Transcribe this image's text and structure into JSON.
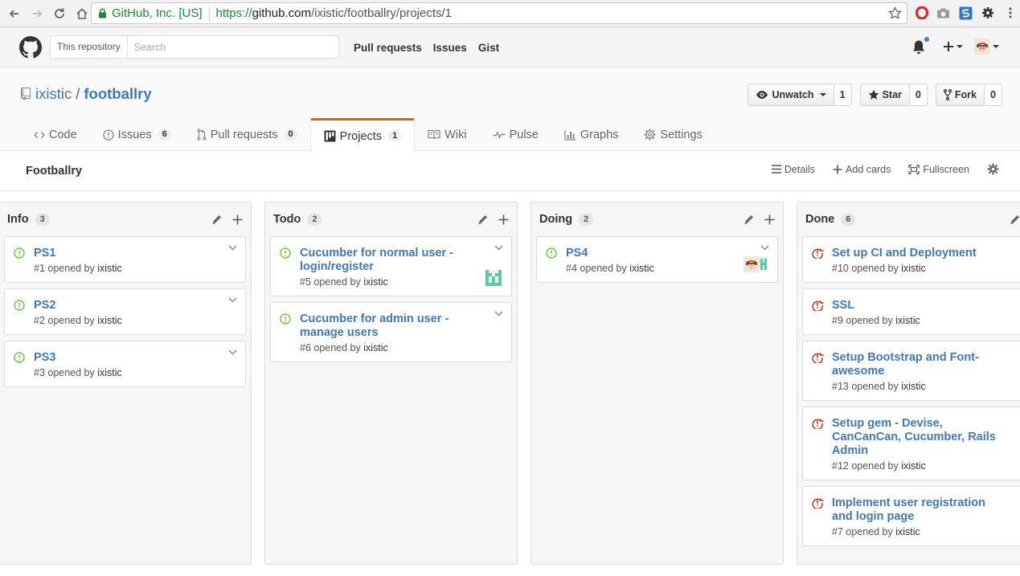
{
  "browser": {
    "secure_label": "GitHub, Inc. [US]",
    "url_scheme": "https://",
    "url_host": "github.com",
    "url_path": "/ixistic/footballry/projects/1"
  },
  "header": {
    "scope_label": "This repository",
    "search_placeholder": "Search",
    "nav": [
      "Pull requests",
      "Issues",
      "Gist"
    ]
  },
  "repo": {
    "owner": "ixistic",
    "separator": "/",
    "name": "footballry",
    "actions": {
      "watch_label": "Unwatch",
      "watch_count": "1",
      "star_label": "Star",
      "star_count": "0",
      "fork_label": "Fork",
      "fork_count": "0"
    },
    "tabs": [
      {
        "label": "Code",
        "icon": "code-icon",
        "counter": ""
      },
      {
        "label": "Issues",
        "icon": "issue-opened-icon",
        "counter": "6"
      },
      {
        "label": "Pull requests",
        "icon": "git-pull-request-icon",
        "counter": "0"
      },
      {
        "label": "Projects",
        "icon": "project-icon",
        "counter": "1",
        "selected": true
      },
      {
        "label": "Wiki",
        "icon": "book-icon",
        "counter": ""
      },
      {
        "label": "Pulse",
        "icon": "pulse-icon",
        "counter": ""
      },
      {
        "label": "Graphs",
        "icon": "graph-icon",
        "counter": ""
      },
      {
        "label": "Settings",
        "icon": "gear-icon",
        "counter": ""
      }
    ]
  },
  "project": {
    "name": "Footballry",
    "actions": {
      "details": "Details",
      "add_cards": "Add cards",
      "fullscreen": "Fullscreen"
    },
    "columns": [
      {
        "name": "Info",
        "count": "3",
        "cards": [
          {
            "title": "PS1",
            "meta_prefix": "#1 opened by",
            "author": "ixistic",
            "state": "open",
            "avatar": ""
          },
          {
            "title": "PS2",
            "meta_prefix": "#2 opened by",
            "author": "ixistic",
            "state": "open",
            "avatar": ""
          },
          {
            "title": "PS3",
            "meta_prefix": "#3 opened by",
            "author": "ixistic",
            "state": "open",
            "avatar": ""
          }
        ]
      },
      {
        "name": "Todo",
        "count": "2",
        "cards": [
          {
            "title": "Cucumber for normal user - login/register",
            "meta_prefix": "#5 opened by",
            "author": "ixistic",
            "state": "open",
            "avatar": "identicon"
          },
          {
            "title": "Cucumber for admin user - manage users",
            "meta_prefix": "#6 opened by",
            "author": "ixistic",
            "state": "open",
            "avatar": ""
          }
        ]
      },
      {
        "name": "Doing",
        "count": "2",
        "cards": [
          {
            "title": "PS4",
            "meta_prefix": "#4 opened by",
            "author": "ixistic",
            "state": "open",
            "avatar": "pair"
          }
        ]
      },
      {
        "name": "Done",
        "count": "6",
        "cards": [
          {
            "title": "Set up CI and Deployment",
            "meta_prefix": "#10 opened by",
            "author": "ixistic",
            "state": "closed",
            "avatar": ""
          },
          {
            "title": "SSL",
            "meta_prefix": "#9 opened by",
            "author": "ixistic",
            "state": "closed",
            "avatar": ""
          },
          {
            "title": "Setup Bootstrap and Font-awesome",
            "meta_prefix": "#13 opened by",
            "author": "ixistic",
            "state": "closed",
            "avatar": ""
          },
          {
            "title": "Setup gem - Devise, CanCanCan, Cucumber, Rails Admin",
            "meta_prefix": "#12 opened by",
            "author": "ixistic",
            "state": "closed",
            "avatar": ""
          },
          {
            "title": "Implement user registration and login page",
            "meta_prefix": "#7 opened by",
            "author": "ixistic",
            "state": "closed",
            "avatar": ""
          }
        ]
      }
    ]
  },
  "colors": {
    "link": "#4078c0",
    "open_icon": "#6cc644",
    "closed_icon": "#bd2c00",
    "tab_accent": "#e36209",
    "notification_dot": "#4183c4"
  }
}
